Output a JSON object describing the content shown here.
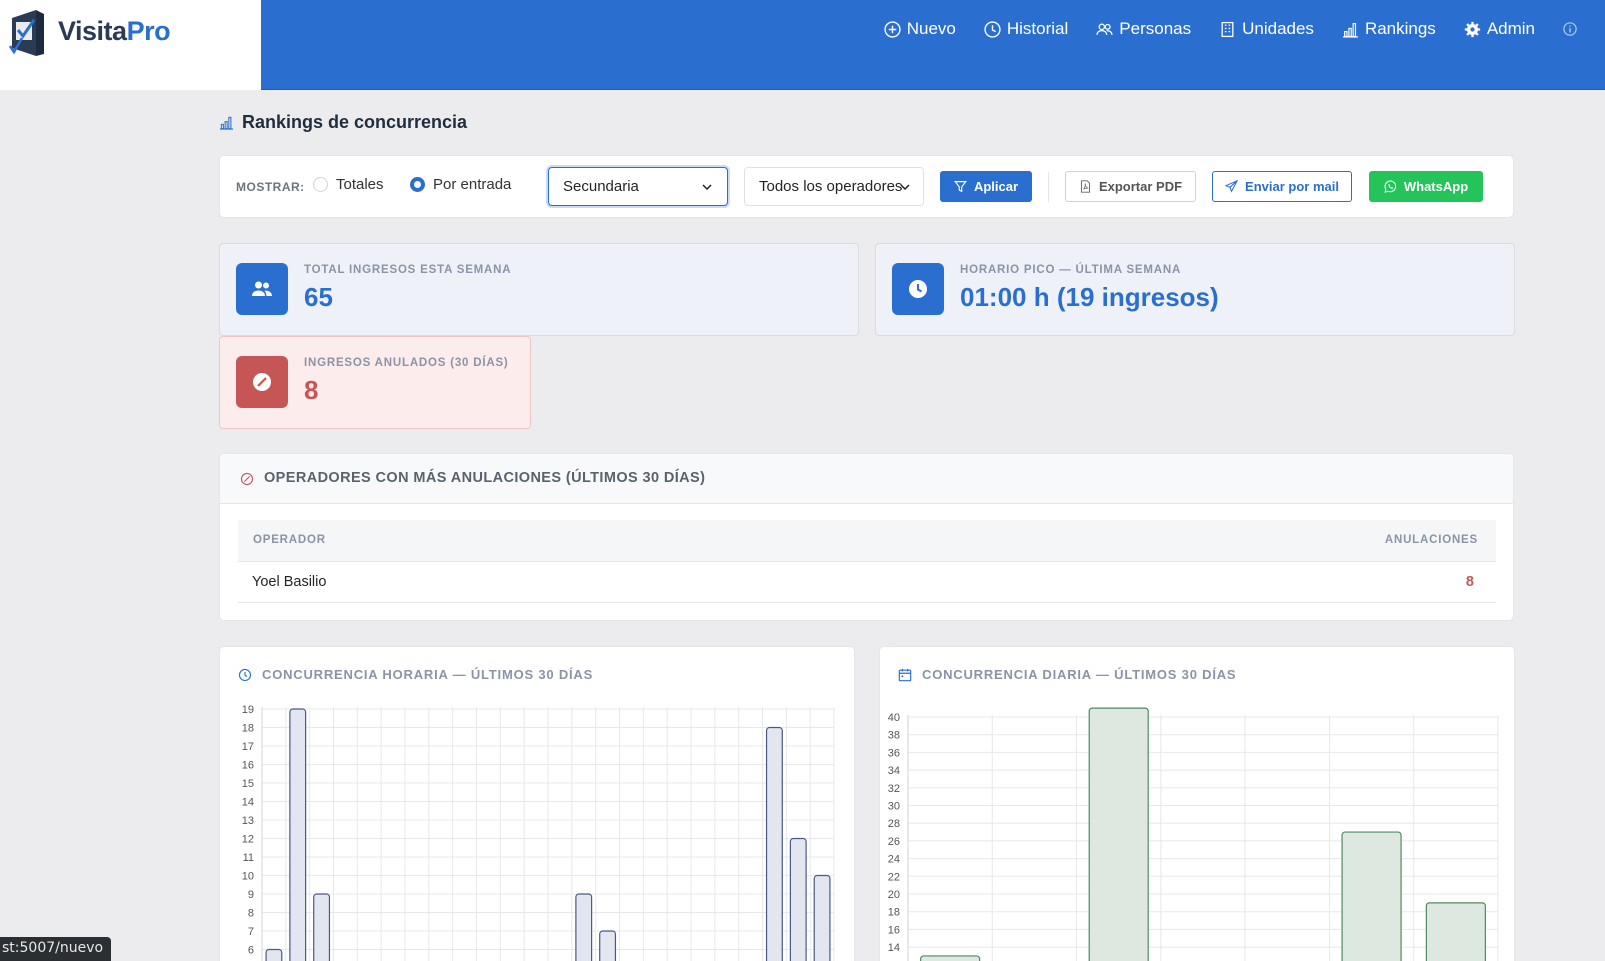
{
  "brand": {
    "name_a": "Visita",
    "name_b": "Pro"
  },
  "nav": [
    {
      "label": "Nuevo",
      "icon": "plus-circle-icon"
    },
    {
      "label": "Historial",
      "icon": "clock-icon"
    },
    {
      "label": "Personas",
      "icon": "people-icon"
    },
    {
      "label": "Unidades",
      "icon": "building-icon"
    },
    {
      "label": "Rankings",
      "icon": "bar-chart-icon"
    },
    {
      "label": "Admin",
      "icon": "gear-icon"
    }
  ],
  "page": {
    "title": "Rankings de concurrencia"
  },
  "toolbar": {
    "mostrar_label": "MOSTRAR:",
    "radio_totales": "Totales",
    "radio_por_entrada": "Por entrada",
    "selected_radio": "por_entrada",
    "entrada_select": "Secundaria",
    "operador_select": "Todos los operadores",
    "aplicar": "Aplicar",
    "exportar_pdf": "Exportar PDF",
    "enviar_mail": "Enviar por mail",
    "whatsapp": "WhatsApp"
  },
  "stats": {
    "total_label": "TOTAL INGRESOS ESTA SEMANA",
    "total_value": "65",
    "pico_label": "HORARIO PICO — ÚLTIMA SEMANA",
    "pico_value": "01:00 h (19 ingresos)",
    "anulados_label": "INGRESOS ANULADOS (30 DÍAS)",
    "anulados_value": "8"
  },
  "anulaciones": {
    "title": "OPERADORES CON MÁS ANULACIONES (ÚLTIMOS 30 DÍAS)",
    "col_operador": "OPERADOR",
    "col_anulaciones": "ANULACIONES",
    "rows": [
      {
        "operador": "Yoel Basilio",
        "anulaciones": "8"
      }
    ]
  },
  "charts": {
    "horaria_title": "CONCURRENCIA HORARIA — ÚLTIMOS 30 DÍAS",
    "diaria_title": "CONCURRENCIA DIARIA — ÚLTIMOS 30 DÍAS"
  },
  "chart_data": [
    {
      "type": "bar",
      "title": "CONCURRENCIA HORARIA — ÚLTIMOS 30 DÍAS",
      "yticks": [
        6,
        7,
        8,
        9,
        10,
        11,
        12,
        13,
        14,
        15,
        16,
        17,
        18,
        19
      ],
      "ymax": 19,
      "slots": 24,
      "values": [
        6,
        19,
        9,
        0,
        0,
        0,
        0,
        0,
        0,
        0,
        0,
        0,
        0,
        9,
        7,
        0,
        0,
        0,
        0,
        0,
        0,
        18,
        12,
        10
      ],
      "colors": {
        "fill": "#e2e6f0",
        "stroke": "#4a5a82"
      }
    },
    {
      "type": "bar",
      "title": "CONCURRENCIA DIARIA — ÚLTIMOS 30 DÍAS",
      "yticks": [
        14,
        16,
        18,
        20,
        22,
        24,
        26,
        28,
        30,
        32,
        34,
        36,
        38,
        40
      ],
      "ymax": 40,
      "slots": 7,
      "values": [
        13,
        0,
        41,
        0,
        0,
        27,
        19
      ],
      "colors": {
        "fill": "#dde9e0",
        "stroke": "#4e8a62"
      }
    }
  ],
  "statusbar": {
    "url": "st:5007/nuevo"
  }
}
